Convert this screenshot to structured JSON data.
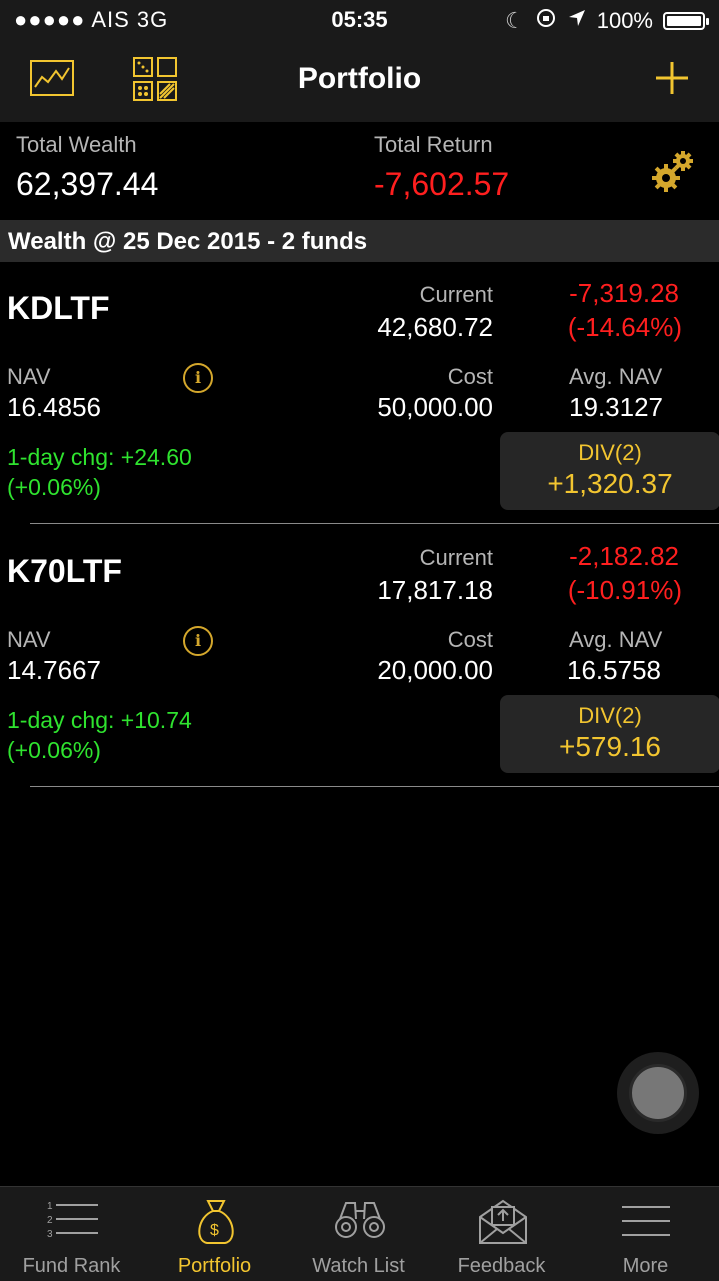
{
  "status_bar": {
    "carrier": "●●●●● AIS   3G",
    "time": "05:35",
    "battery": "100%"
  },
  "nav": {
    "title": "Portfolio"
  },
  "summary": {
    "total_wealth_label": "Total Wealth",
    "total_wealth": "62,397.44",
    "total_return_label": "Total Return",
    "total_return": "-7,602.57"
  },
  "section_header": "Wealth @ 25 Dec 2015 - 2 funds",
  "funds": [
    {
      "name": "KDLTF",
      "current_label": "Current",
      "current": "42,680.72",
      "pl": "-7,319.28",
      "pl_pct": "(-14.64%)",
      "nav_label": "NAV",
      "nav": "16.4856",
      "cost_label": "Cost",
      "cost": "50,000.00",
      "avg_nav_label": "Avg. NAV",
      "avg_nav": "19.3127",
      "chg": "1-day chg: +24.60",
      "chg_pct": "(+0.06%)",
      "div_label": "DIV(2)",
      "div_value": "+1,320.37",
      "info_glyph": "i"
    },
    {
      "name": "K70LTF",
      "current_label": "Current",
      "current": "17,817.18",
      "pl": "-2,182.82",
      "pl_pct": "(-10.91%)",
      "nav_label": "NAV",
      "nav": "14.7667",
      "cost_label": "Cost",
      "cost": "20,000.00",
      "avg_nav_label": "Avg. NAV",
      "avg_nav": "16.5758",
      "chg": "1-day chg: +10.74",
      "chg_pct": "(+0.06%)",
      "div_label": "DIV(2)",
      "div_value": "+579.16",
      "info_glyph": "i"
    }
  ],
  "tabs": [
    {
      "label": "Fund Rank",
      "icon": "numbered-list-icon"
    },
    {
      "label": "Portfolio",
      "icon": "money-bag-icon",
      "active": true
    },
    {
      "label": "Watch List",
      "icon": "binoculars-icon"
    },
    {
      "label": "Feedback",
      "icon": "envelope-icon"
    },
    {
      "label": "More",
      "icon": "menu-icon"
    }
  ],
  "colors": {
    "accent": "#f2c530",
    "negative": "#ff1f1f",
    "positive": "#2fe32f",
    "background": "#000000"
  }
}
